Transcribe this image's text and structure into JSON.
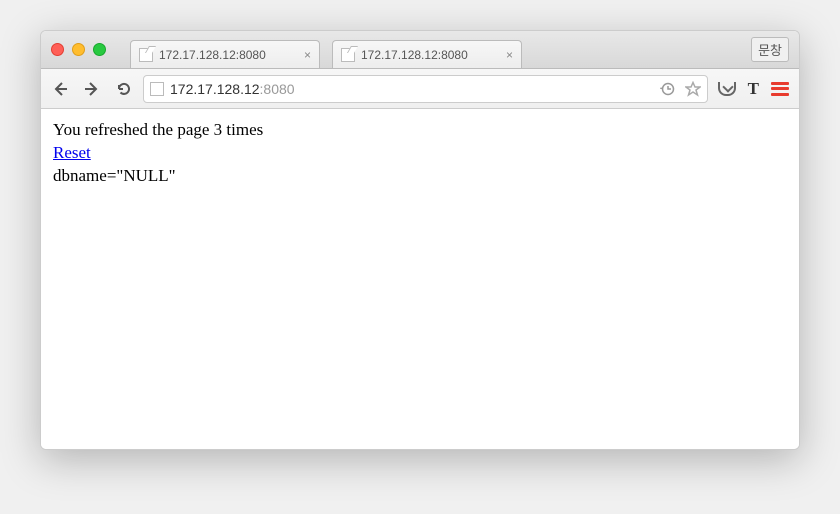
{
  "window": {
    "menu_button": "문창"
  },
  "tabs": [
    {
      "title": "172.17.128.12:8080"
    },
    {
      "title": "172.17.128.12:8080"
    }
  ],
  "address": {
    "host": "172.17.128.12",
    "port": ":8080"
  },
  "page": {
    "line1": "You refreshed the page 3 times",
    "reset_link": "Reset",
    "line3": "dbname=\"NULL\""
  }
}
